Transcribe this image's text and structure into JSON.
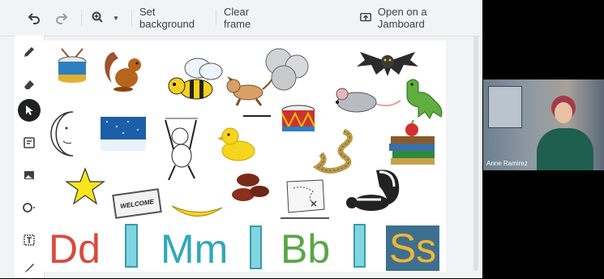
{
  "toolbar": {
    "set_background": "Set background",
    "clear_frame": "Clear frame",
    "open_jamboard": "Open on a Jamboard"
  },
  "canvas": {
    "welcome_mat_text": "WELCOME",
    "letters": [
      {
        "text": "Dd",
        "color": "#d94b3d"
      },
      {
        "text": "Mm",
        "color": "#31a8b8"
      },
      {
        "text": "Bb",
        "color": "#5aa646"
      },
      {
        "text": "Ss",
        "color": "#f2b632",
        "bg": "#3f6f8f"
      }
    ]
  },
  "video": {
    "participant_name": "Anne Ramirez"
  }
}
